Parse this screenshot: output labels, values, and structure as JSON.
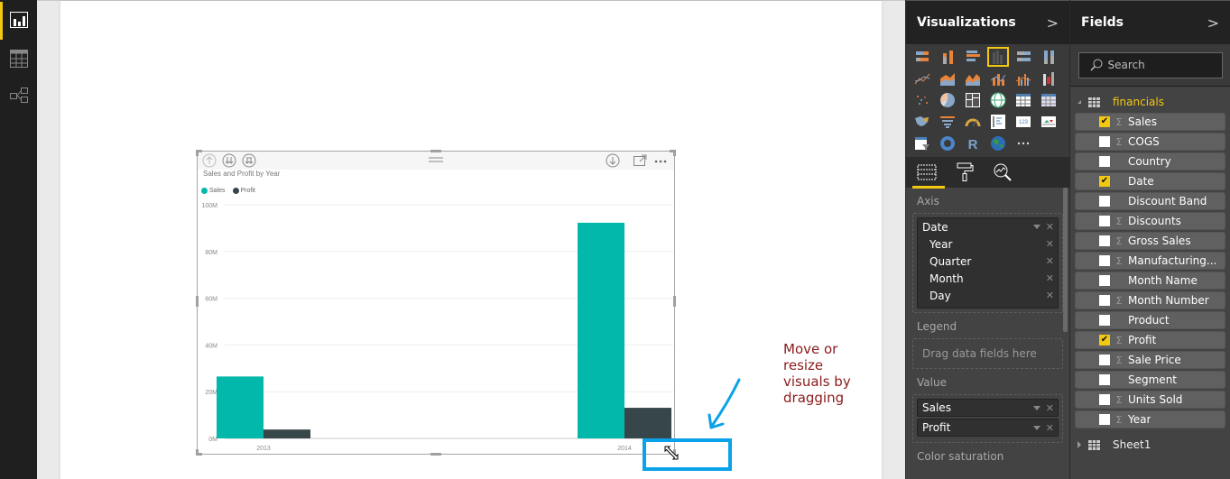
{
  "nav": {
    "items": [
      {
        "name": "report-view",
        "active": true
      },
      {
        "name": "data-view",
        "active": false
      },
      {
        "name": "relationships-view",
        "active": false
      }
    ]
  },
  "visual": {
    "title": "Sales and Profit by Year",
    "legend": [
      {
        "label": "Sales",
        "color": "#01b8aa"
      },
      {
        "label": "Profit",
        "color": "#374649"
      }
    ]
  },
  "chart_data": {
    "type": "bar",
    "title": "Sales and Profit by Year",
    "categories": [
      "2013",
      "2014"
    ],
    "series": [
      {
        "name": "Sales",
        "color": "#01b8aa",
        "values": [
          26.5,
          92.3
        ]
      },
      {
        "name": "Profit",
        "color": "#374649",
        "values": [
          3.8,
          13.1
        ]
      }
    ],
    "yunit": "M",
    "ylim": [
      0,
      100
    ],
    "yticks": [
      "0M",
      "20M",
      "40M",
      "60M",
      "80M",
      "100M"
    ],
    "ytick_values": [
      0,
      20,
      40,
      60,
      80,
      100
    ],
    "grid": true,
    "legend_position": "top-left",
    "xlabel": "",
    "ylabel": ""
  },
  "annotation": {
    "line1": "Move or resize",
    "line2": "visuals by dragging",
    "arrow_color": "#0aa2e8",
    "text_color": "#8b1a1a"
  },
  "visualizations": {
    "title": "Visualizations",
    "selected_index": 3,
    "tabs": [
      "fields-tab",
      "format-tab",
      "analytics-tab"
    ],
    "wells": {
      "axis": {
        "label": "Axis",
        "field": "Date",
        "hierarchy": [
          "Year",
          "Quarter",
          "Month",
          "Day"
        ]
      },
      "legend": {
        "label": "Legend",
        "placeholder": "Drag data fields here"
      },
      "value": {
        "label": "Value",
        "fields": [
          "Sales",
          "Profit"
        ]
      },
      "color_saturation": {
        "label": "Color saturation"
      }
    }
  },
  "fields": {
    "title": "Fields",
    "search_placeholder": "Search",
    "tables": [
      {
        "name": "financials",
        "expanded": true,
        "items": [
          {
            "name": "Sales",
            "checked": true,
            "sigma": true
          },
          {
            "name": "COGS",
            "checked": false,
            "sigma": true
          },
          {
            "name": "Country",
            "checked": false,
            "sigma": false
          },
          {
            "name": "Date",
            "checked": true,
            "sigma": false
          },
          {
            "name": "Discount Band",
            "checked": false,
            "sigma": false
          },
          {
            "name": "Discounts",
            "checked": false,
            "sigma": true
          },
          {
            "name": "Gross Sales",
            "checked": false,
            "sigma": true
          },
          {
            "name": "Manufacturing...",
            "checked": false,
            "sigma": true
          },
          {
            "name": "Month Name",
            "checked": false,
            "sigma": false
          },
          {
            "name": "Month Number",
            "checked": false,
            "sigma": true
          },
          {
            "name": "Product",
            "checked": false,
            "sigma": false
          },
          {
            "name": "Profit",
            "checked": true,
            "sigma": true
          },
          {
            "name": "Sale Price",
            "checked": false,
            "sigma": true
          },
          {
            "name": "Segment",
            "checked": false,
            "sigma": false
          },
          {
            "name": "Units Sold",
            "checked": false,
            "sigma": true
          },
          {
            "name": "Year",
            "checked": false,
            "sigma": true
          }
        ]
      },
      {
        "name": "Sheet1",
        "expanded": false,
        "items": []
      }
    ]
  }
}
